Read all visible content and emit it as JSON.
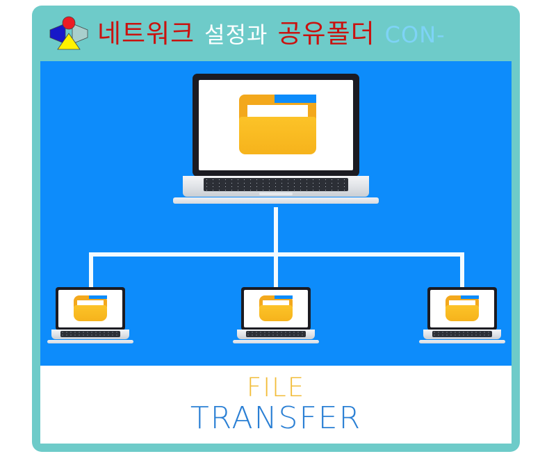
{
  "card": {
    "background_color": "#6ecbc9"
  },
  "header": {
    "logo_icon": "abstract-bowtie-figure-logo",
    "logo_colors": {
      "circle": "#ec1c24",
      "left_triangle": "#1718c8",
      "right_triangle": "#a9cfcd",
      "bottom_triangle": "#fff200"
    },
    "title_segments": [
      {
        "text": "네트워크",
        "color": "#c9120f"
      },
      {
        "text": "설정과",
        "color": "#ffffff"
      },
      {
        "text": "공유폴더",
        "color": "#c9120f"
      },
      {
        "text": "CON-",
        "color": "#7ed3f6"
      }
    ],
    "title_full": "네트워크 설정과 공유폴더 CON-"
  },
  "illustration": {
    "background_color": "#0d8cfb",
    "topology": "one-to-many-tree",
    "link_color": "#f2fbff",
    "main_device": {
      "name": "main-laptop",
      "screen_icon": "folder-icon",
      "screen_background": "#ffffff"
    },
    "client_devices": [
      {
        "name": "client-laptop-1",
        "screen_icon": "folder-icon"
      },
      {
        "name": "client-laptop-2",
        "screen_icon": "folder-icon"
      },
      {
        "name": "client-laptop-3",
        "screen_icon": "folder-icon"
      }
    ],
    "folder_colors": {
      "back": "#f3a81c",
      "front": "#fcc328",
      "paper": "#ffffff"
    }
  },
  "footer": {
    "line1": "FILE",
    "line2": "TRANSFER",
    "line1_color": "#f2bd3a",
    "line2_color": "#2a7fd4",
    "background_color": "#ffffff"
  }
}
